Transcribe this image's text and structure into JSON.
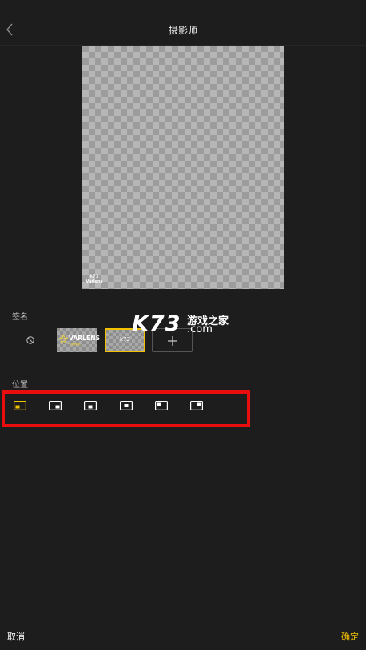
{
  "header": {
    "title": "摄影师",
    "back_icon": "chevron-left-icon"
  },
  "preview": {
    "watermark_text": "k73",
    "watermark_subtext": "Varlens"
  },
  "signature": {
    "label": "签名",
    "options": [
      {
        "name": "none",
        "icon": "no-signature-icon"
      },
      {
        "name": "varlens",
        "brand": "VARLENS",
        "subtext": "大神级相机"
      },
      {
        "name": "k73",
        "text": "k73",
        "selected": true
      },
      {
        "name": "add",
        "icon": "plus-icon"
      }
    ]
  },
  "overlay_watermark": {
    "brand": "K73",
    "cn_text": "游戏之家",
    "domain": ".com"
  },
  "position": {
    "label": "位置",
    "selected_index": 0,
    "options": [
      {
        "name": "bottom-left"
      },
      {
        "name": "bottom-right"
      },
      {
        "name": "bottom-center"
      },
      {
        "name": "center"
      },
      {
        "name": "top-left"
      },
      {
        "name": "top-right"
      }
    ]
  },
  "footer": {
    "cancel_label": "取消",
    "confirm_label": "确定"
  },
  "colors": {
    "background": "#1d1d1d",
    "accent": "#f2c200",
    "highlight_box": "#ea0d0d"
  }
}
